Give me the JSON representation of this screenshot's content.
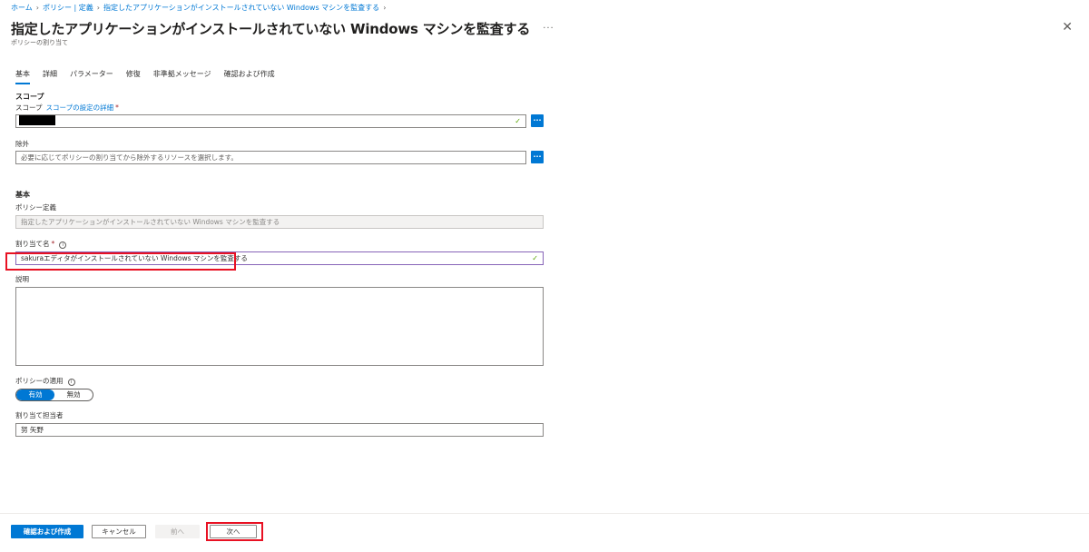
{
  "breadcrumb": [
    {
      "label": "ホーム"
    },
    {
      "label": "ポリシー | 定義"
    },
    {
      "label": "指定したアプリケーションがインストールされていない Windows マシンを監査する"
    }
  ],
  "header": {
    "title": "指定したアプリケーションがインストールされていない Windows マシンを監査する",
    "more": "···",
    "subtitle": "ポリシーの割り当て",
    "close": "✕"
  },
  "tabs": [
    {
      "label": "基本",
      "active": true
    },
    {
      "label": "詳細"
    },
    {
      "label": "パラメーター"
    },
    {
      "label": "修復"
    },
    {
      "label": "非準拠メッセージ"
    },
    {
      "label": "確認および作成"
    }
  ],
  "scope": {
    "section_title": "スコープ",
    "label": "スコープ",
    "link": "スコープの設定の詳細",
    "required": "*",
    "value_redacted": true,
    "browse": "..."
  },
  "exclusions": {
    "label": "除外",
    "placeholder": "必要に応じてポリシーの割り当てから除外するリソースを選択します。",
    "browse": "..."
  },
  "basics": {
    "section_title": "基本",
    "policy_definition_label": "ポリシー定義",
    "policy_definition_value": "指定したアプリケーションがインストールされていない Windows マシンを監査する",
    "assignment_name_label": "割り当て名",
    "required": "*",
    "info": "i",
    "assignment_name_value": "sakuraエディタがインストールされていない Windows マシンを監査する",
    "description_label": "説明",
    "enforcement_label": "ポリシーの適用",
    "enforcement_on": "有効",
    "enforcement_off": "無効",
    "assigned_by_label": "割り当て担当者",
    "assigned_by_value": "努 矢野"
  },
  "footer": {
    "review_create": "確認および作成",
    "cancel": "キャンセル",
    "previous": "前へ",
    "next": "次へ"
  },
  "colors": {
    "accent": "#0078d4",
    "highlight": "#e81123",
    "valid_check": "#57a300"
  }
}
